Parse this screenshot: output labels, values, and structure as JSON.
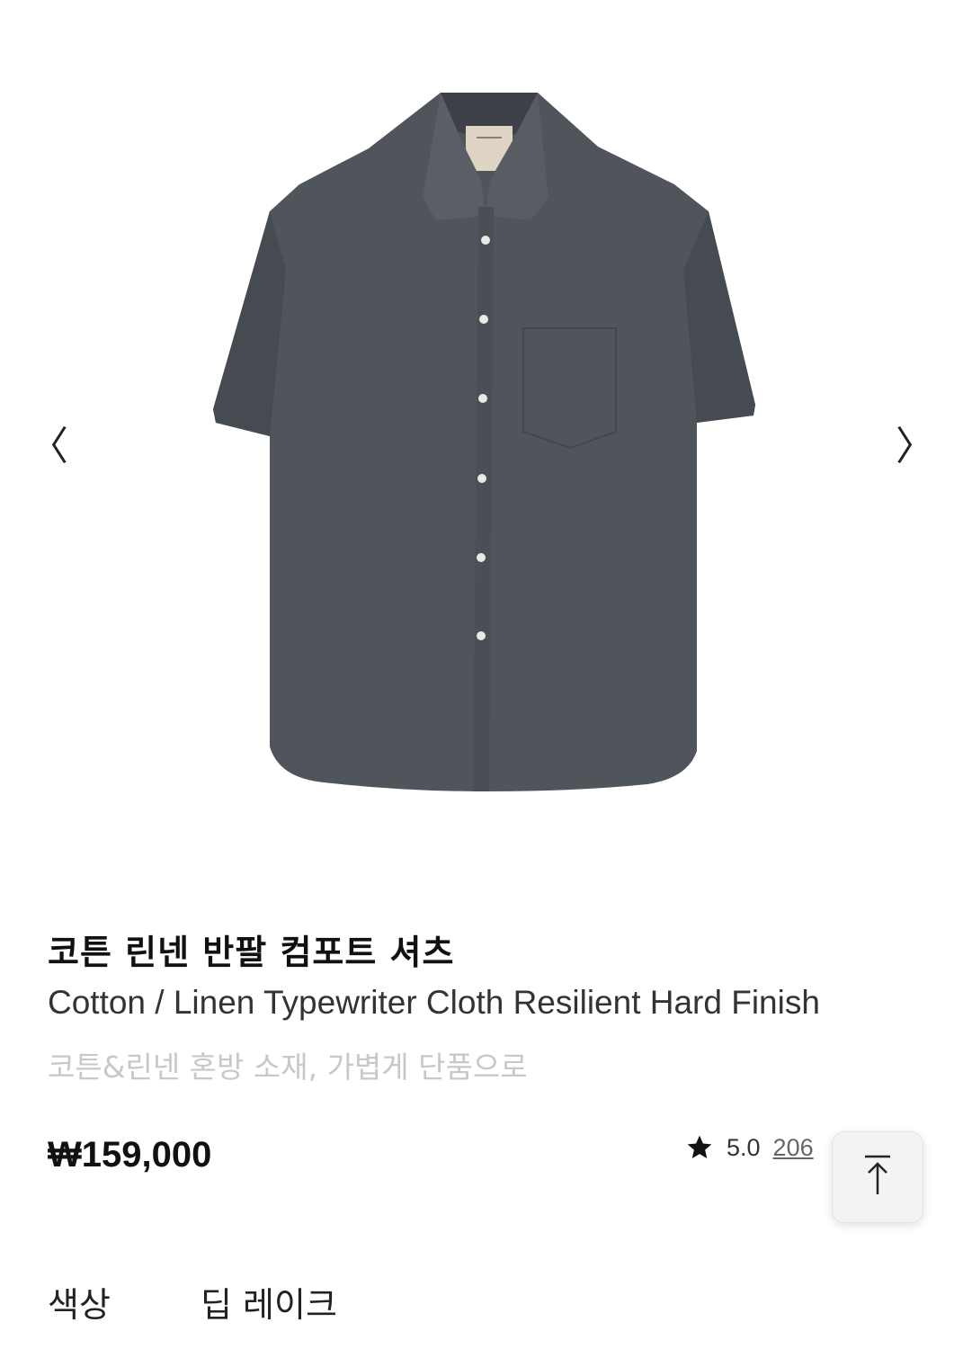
{
  "gallery": {
    "image_alt": "Charcoal grey short-sleeve shirt",
    "prev_icon": "chevron-left-icon",
    "next_icon": "chevron-right-icon",
    "prev_glyph": "〈",
    "next_glyph": "〉"
  },
  "product": {
    "title": "코튼 린넨 반팔 컴포트 셔츠",
    "subtitle": "Cotton / Linen Typewriter Cloth Resilient Hard Finish",
    "description": "코튼&린넨 혼방 소재, 가볍게 단품으로",
    "price": "₩159,000",
    "rating": "5.0",
    "review_count": "206"
  },
  "options": {
    "color_label": "색상",
    "color_value": "딥 레이크"
  },
  "colors": {
    "shirt": "#50555c",
    "text_primary": "#111111",
    "text_muted": "#c8c8c8"
  }
}
